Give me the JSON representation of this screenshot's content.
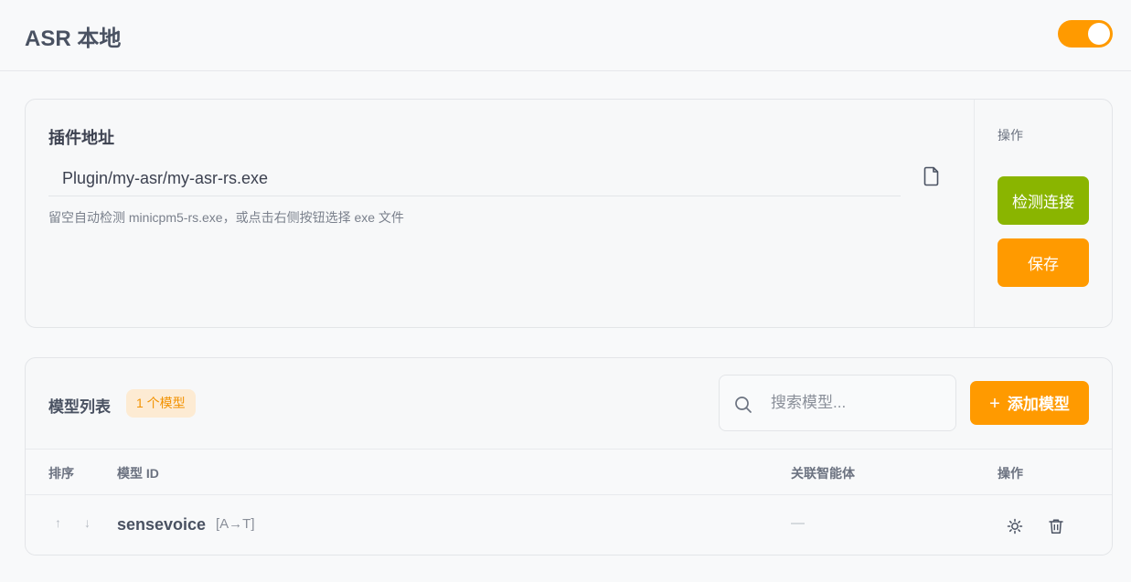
{
  "header": {
    "title": "ASR 本地",
    "enabled": true,
    "toggle_color": "#ff9a00"
  },
  "plugin": {
    "label": "插件地址",
    "path_value": "Plugin/my-asr/my-asr-rs.exe",
    "hint": "留空自动检测 minicpm5-rs.exe，或点击右侧按钮选择 exe 文件",
    "browse_icon": "file-icon",
    "ops_label": "操作",
    "check_button": "检测连接",
    "save_button": "保存",
    "check_color": "#8ab500",
    "save_color": "#ff9a00"
  },
  "models": {
    "title": "模型列表",
    "count_badge": "1 个模型",
    "search_placeholder": "搜索模型...",
    "search_icon": "search-icon",
    "add_button_plus": "+",
    "add_button": "添加模型",
    "columns": {
      "order": "排序",
      "model_id": "模型 ID",
      "agents": "关联智能体",
      "actions": "操作"
    },
    "rows": [
      {
        "up_arrow": "↑",
        "down_arrow": "↓",
        "model_id": "sensevoice",
        "tag": "[A→T]",
        "agents": "—",
        "actions": [
          "gear-icon",
          "trash-icon"
        ]
      }
    ]
  }
}
